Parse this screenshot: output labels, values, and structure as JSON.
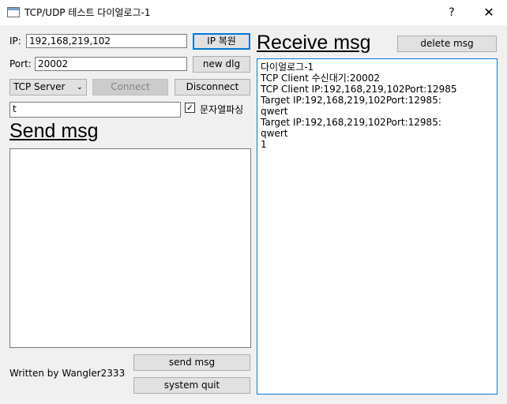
{
  "window": {
    "title": "TCP/UDP 테스트 다이얼로그-1",
    "help_label": "?",
    "close_label": "✕",
    "app_icon": "window-icon"
  },
  "connection": {
    "ip_label": "IP:",
    "ip_value": "192,168,219,102",
    "port_label": "Port:",
    "port_value": "20002",
    "ip_restore_button": "IP 복원",
    "new_dlg_button": "new dlg",
    "mode_selected": "TCP Server",
    "connect_button": "Connect",
    "disconnect_button": "Disconnect"
  },
  "parse": {
    "input_value": "t",
    "checkbox_checked": true,
    "checkbox_mark": "✓",
    "checkbox_label": "문자열파싱"
  },
  "send": {
    "heading": "Send msg",
    "message": "",
    "send_button": "send msg",
    "quit_button": "system quit"
  },
  "footer": {
    "author": "Written by Wangler2333"
  },
  "receive": {
    "heading": "Receive msg",
    "delete_button": "delete msg",
    "lines": [
      "다이얼로그-1",
      "TCP Client 수신대기:20002",
      "TCP Client IP:192,168,219,102Port:12985",
      "Target IP:192,168,219,102Port:12985:",
      "qwert",
      "Target IP:192,168,219,102Port:12985:",
      "qwert",
      "1"
    ]
  },
  "colors": {
    "focus_border": "#0078d7",
    "background": "#f0f0f0",
    "button_face": "#e1e1e1"
  }
}
